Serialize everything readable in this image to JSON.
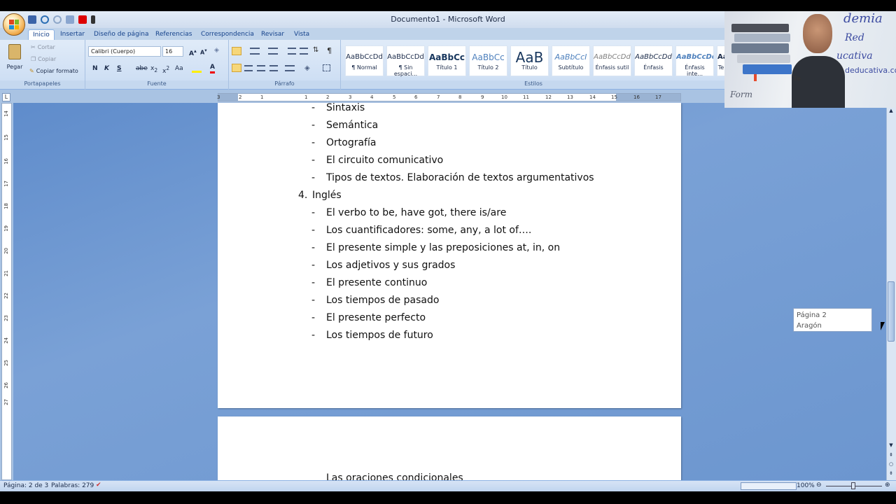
{
  "window": {
    "title": "Documento1 - Microsoft Word"
  },
  "tabs": [
    "Inicio",
    "Insertar",
    "Diseño de página",
    "Referencias",
    "Correspondencia",
    "Revisar",
    "Vista"
  ],
  "clipboard": {
    "paste": "Pegar",
    "cut": "Cortar",
    "copy": "Copiar",
    "format_painter": "Copiar formato",
    "group": "Portapapeles"
  },
  "font": {
    "name": "Calibri (Cuerpo)",
    "size": "16",
    "group": "Fuente"
  },
  "paragraph": {
    "group": "Párrafo"
  },
  "styles": {
    "group": "Estilos",
    "items": [
      {
        "preview": "AaBbCcDd",
        "name": "¶ Normal"
      },
      {
        "preview": "AaBbCcDd",
        "name": "¶ Sin espaci..."
      },
      {
        "preview": "AaBbCc",
        "name": "Título 1"
      },
      {
        "preview": "AaBbCc",
        "name": "Título 2"
      },
      {
        "preview": "AaB",
        "name": "Título"
      },
      {
        "preview": "AaBbCcI",
        "name": "Subtítulo"
      },
      {
        "preview": "AaBbCcDd",
        "name": "Énfasis sutil"
      },
      {
        "preview": "AaBbCcDd",
        "name": "Énfasis"
      },
      {
        "preview": "AaBbCcDd",
        "name": "Énfasis inte..."
      },
      {
        "preview": "Aa",
        "name": "Te"
      }
    ]
  },
  "ruler": {
    "ticks": [
      "3",
      "2",
      "1",
      "1",
      "2",
      "3",
      "4",
      "5",
      "6",
      "7",
      "8",
      "9",
      "10",
      "11",
      "12",
      "13",
      "14",
      "15",
      "16",
      "17"
    ]
  },
  "vruler": {
    "ticks": [
      "14",
      "15",
      "16",
      "17",
      "18",
      "19",
      "20",
      "21",
      "22",
      "23",
      "24",
      "25",
      "26",
      "27"
    ]
  },
  "document": {
    "lines": [
      {
        "type": "dash",
        "text": "Sintaxis"
      },
      {
        "type": "dash",
        "text": "Semántica"
      },
      {
        "type": "dash",
        "text": "Ortografía"
      },
      {
        "type": "dash",
        "text": "El circuito comunicativo"
      },
      {
        "type": "dash",
        "text": "Tipos de textos. Elaboración de textos argumentativos"
      },
      {
        "type": "numbered",
        "num": "4.",
        "text": "Inglés"
      },
      {
        "type": "dash",
        "text": "El verbo to be, have got, there is/are"
      },
      {
        "type": "dash",
        "text": "Los cuantificadores: some, any, a lot of…."
      },
      {
        "type": "dash",
        "text": "El presente simple y las preposiciones at, in, on"
      },
      {
        "type": "dash",
        "text": "Los adjetivos y sus grados"
      },
      {
        "type": "dash",
        "text": "El presente continuo"
      },
      {
        "type": "dash",
        "text": "Los tiempos de pasado"
      },
      {
        "type": "dash",
        "text": "El presente perfecto"
      },
      {
        "type": "dash",
        "text": "Los tiempos de futuro"
      }
    ],
    "next_page_line": "Las oraciones condicionales"
  },
  "tooltip": {
    "line1": "Página 2",
    "line2": "Aragón"
  },
  "status": {
    "page": "Página: 2 de 3",
    "words": "Palabras: 279",
    "zoom": "100%"
  },
  "webcam": {
    "t1": "demia",
    "t2": "Red",
    "t3": "ucativa",
    "t4": "deducativa.com",
    "t5": "Form",
    "t6": "Te"
  }
}
